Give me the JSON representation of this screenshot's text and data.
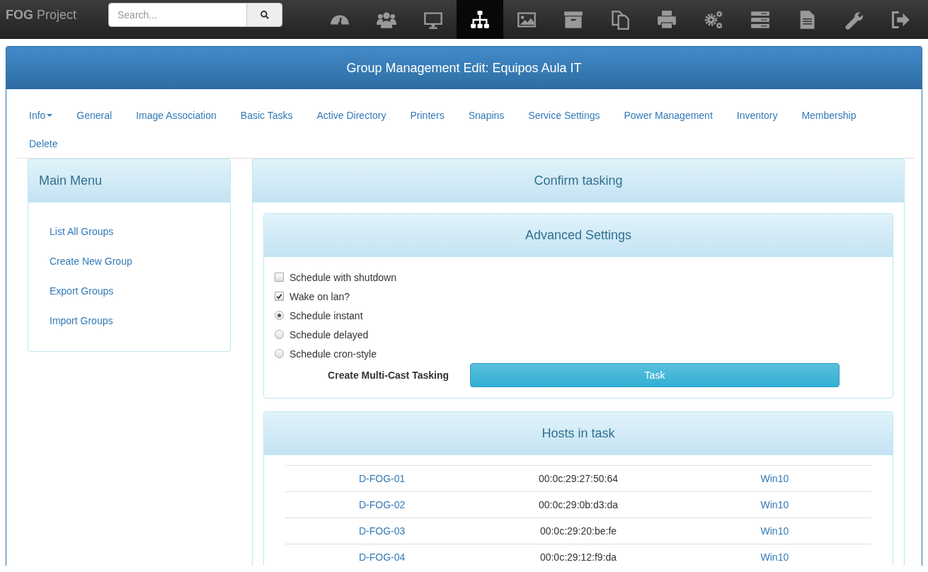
{
  "navbar": {
    "brand_bold": "FOG",
    "brand": "Project",
    "search": {
      "placeholder": "Search..."
    },
    "icons": [
      {
        "kind": "dashboard",
        "selected": false
      },
      {
        "kind": "users",
        "selected": false
      },
      {
        "kind": "monitor",
        "selected": false
      },
      {
        "kind": "sitemap",
        "selected": true
      },
      {
        "kind": "image",
        "selected": false
      },
      {
        "kind": "archive",
        "selected": false
      },
      {
        "kind": "copy",
        "selected": false
      },
      {
        "kind": "printer",
        "selected": false
      },
      {
        "kind": "gears",
        "selected": false
      },
      {
        "kind": "server",
        "selected": false
      },
      {
        "kind": "document",
        "selected": false
      },
      {
        "kind": "wrench",
        "selected": false
      },
      {
        "kind": "signout",
        "selected": false
      }
    ]
  },
  "page_title": "Group Management Edit: Equipos Aula IT",
  "tabs": [
    {
      "label": "Info",
      "dropdown": true
    },
    {
      "label": "General",
      "dropdown": false
    },
    {
      "label": "Image Association",
      "dropdown": false
    },
    {
      "label": "Basic Tasks",
      "dropdown": false
    },
    {
      "label": "Active Directory",
      "dropdown": false
    },
    {
      "label": "Printers",
      "dropdown": false
    },
    {
      "label": "Snapins",
      "dropdown": false
    },
    {
      "label": "Service Settings",
      "dropdown": false
    },
    {
      "label": "Power Management",
      "dropdown": false
    },
    {
      "label": "Inventory",
      "dropdown": false
    },
    {
      "label": "Membership",
      "dropdown": false
    },
    {
      "label": "Delete",
      "dropdown": false
    }
  ],
  "sidebar": {
    "title": "Main Menu",
    "items": [
      "List All Groups",
      "Create New Group",
      "Export Groups",
      "Import Groups"
    ]
  },
  "confirm": {
    "title": "Confirm tasking",
    "advanced": {
      "title": "Advanced Settings",
      "options": [
        {
          "kind": "checkbox",
          "label": "Schedule with shutdown",
          "checked": false
        },
        {
          "kind": "checkbox",
          "label": "Wake on lan?",
          "checked": true
        },
        {
          "kind": "radio",
          "label": "Schedule instant",
          "selected": true
        },
        {
          "kind": "radio",
          "label": "Schedule delayed",
          "selected": false
        },
        {
          "kind": "radio",
          "label": "Schedule cron-style",
          "selected": false
        }
      ],
      "action_label": "Create Multi-Cast Tasking",
      "button": "Task"
    },
    "hosts": {
      "title": "Hosts in task",
      "rows": [
        {
          "name": "D-FOG-01",
          "mac": "00:0c:29:27:50:64",
          "image": "Win10"
        },
        {
          "name": "D-FOG-02",
          "mac": "00:0c:29:0b:d3:da",
          "image": "Win10"
        },
        {
          "name": "D-FOG-03",
          "mac": "00:0c:29:20:be:fe",
          "image": "Win10"
        },
        {
          "name": "D-FOG-04",
          "mac": "00:0c:29:12:f9:da",
          "image": "Win10"
        }
      ]
    }
  }
}
